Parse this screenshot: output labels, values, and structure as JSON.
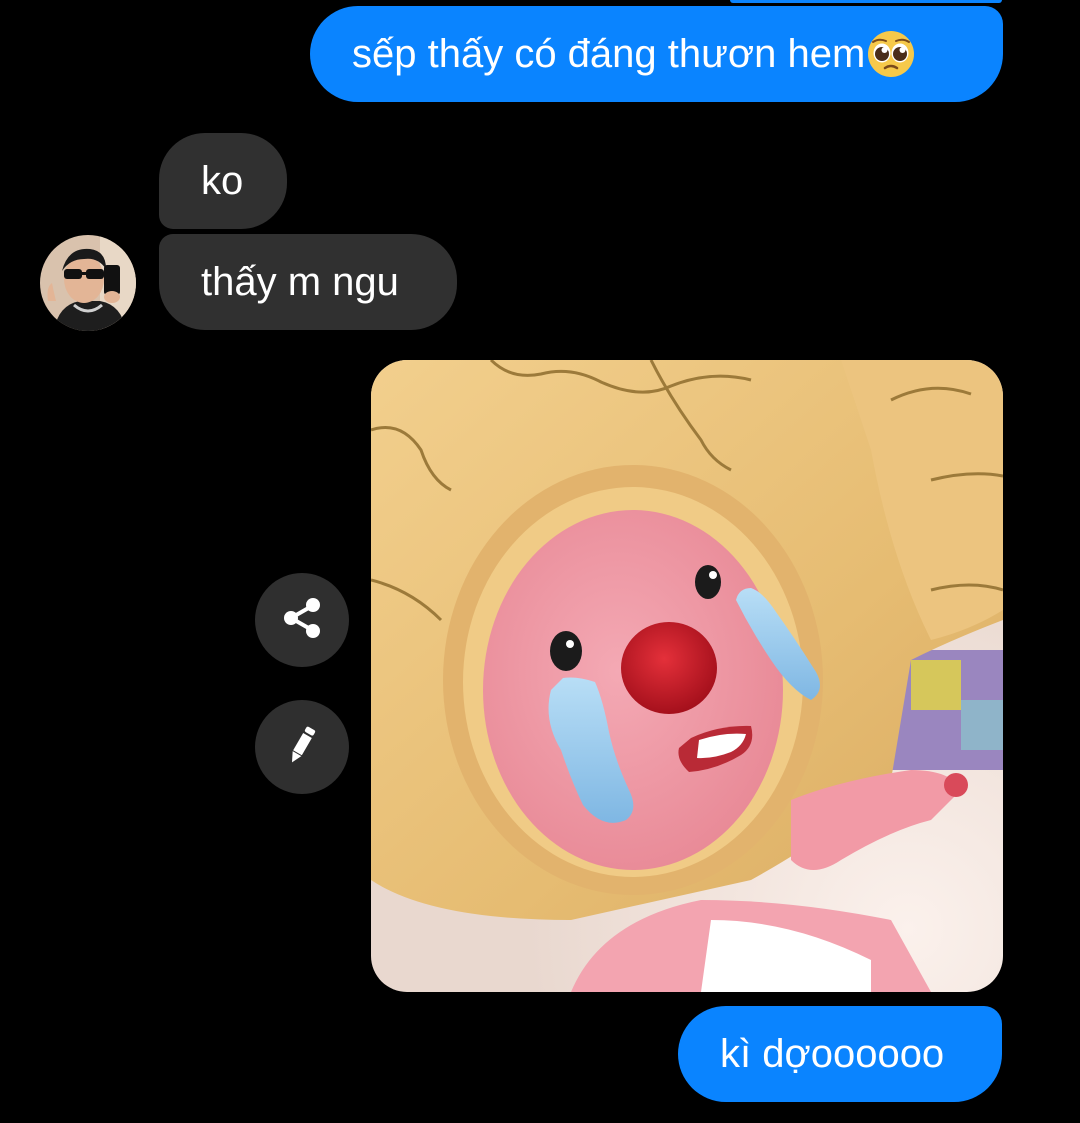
{
  "messages": [
    {
      "sender": "me",
      "text": "sếp thấy có đáng thươn hem",
      "emoji": "pleading-face-emoji"
    },
    {
      "sender": "them",
      "text": "ko"
    },
    {
      "sender": "them",
      "text": "thấy m ngu"
    },
    {
      "sender": "me",
      "type": "image",
      "image": "crying-pink-plush-in-yellow-costume"
    },
    {
      "sender": "me",
      "text": "kì dợoooooo"
    }
  ],
  "actions": {
    "share_icon": "share-icon",
    "edit_icon": "pencil-icon"
  },
  "colors": {
    "background": "#000000",
    "outgoing_bubble": "#0a84ff",
    "incoming_bubble": "#303030",
    "text": "#ffffff",
    "action_button": "#2f2f2f"
  }
}
